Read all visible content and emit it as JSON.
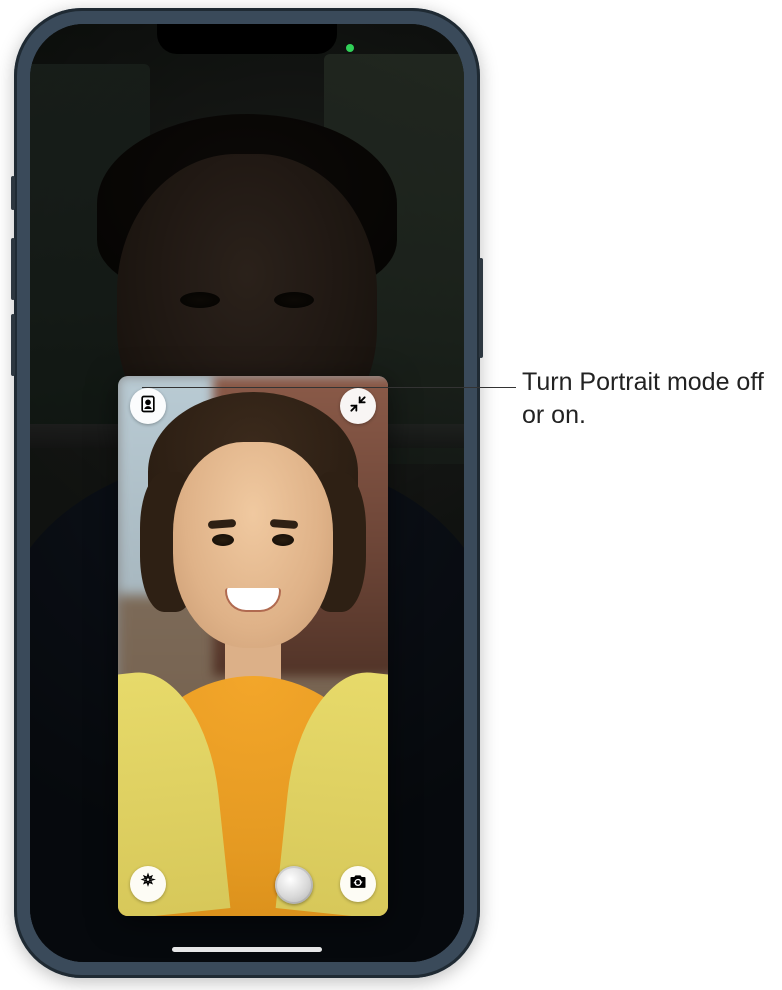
{
  "callout": {
    "text": "Turn Portrait mode off or on."
  },
  "self_tile": {
    "controls": {
      "portrait_mode": "portrait-mode-icon",
      "minimize": "minimize-icon",
      "effects": "effects-icon",
      "shutter": "shutter-button",
      "flip_camera": "flip-camera-icon"
    }
  },
  "status": {
    "camera_active": true
  }
}
